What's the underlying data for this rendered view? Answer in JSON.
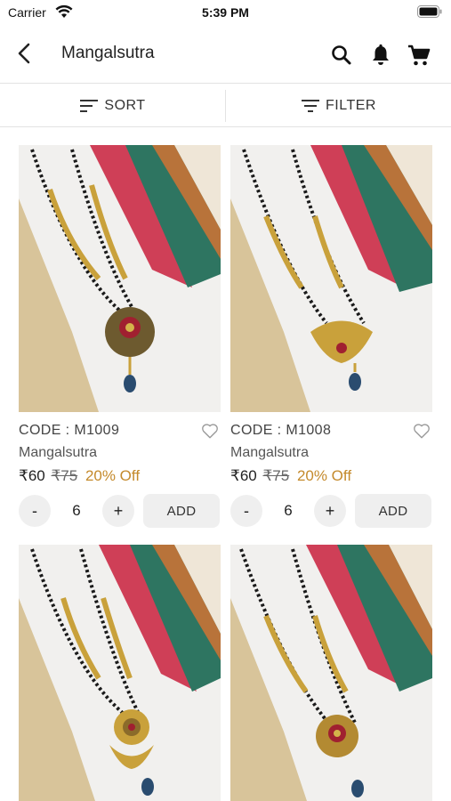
{
  "status_bar": {
    "carrier": "Carrier",
    "time": "5:39 PM"
  },
  "header": {
    "title": "Mangalsutra",
    "icons": [
      "back-icon",
      "search-icon",
      "bell-icon",
      "cart-icon"
    ]
  },
  "toolbar": {
    "sort_label": "SORT",
    "filter_label": "FILTER"
  },
  "colors": {
    "discount": "#c48a2c",
    "button_bg": "#efefef",
    "divider": "#e3e3e3"
  },
  "products": [
    {
      "code": "CODE : M1009",
      "category": "Mangalsutra",
      "price": "₹60",
      "mrp": "₹75",
      "discount": "20% Off",
      "qty_minus": "-",
      "quantity": "6",
      "qty_plus": "+",
      "add_label": "ADD"
    },
    {
      "code": "CODE : M1008",
      "category": "Mangalsutra",
      "price": "₹60",
      "mrp": "₹75",
      "discount": "20% Off",
      "qty_minus": "-",
      "quantity": "6",
      "qty_plus": "+",
      "add_label": "ADD"
    },
    {},
    {}
  ]
}
